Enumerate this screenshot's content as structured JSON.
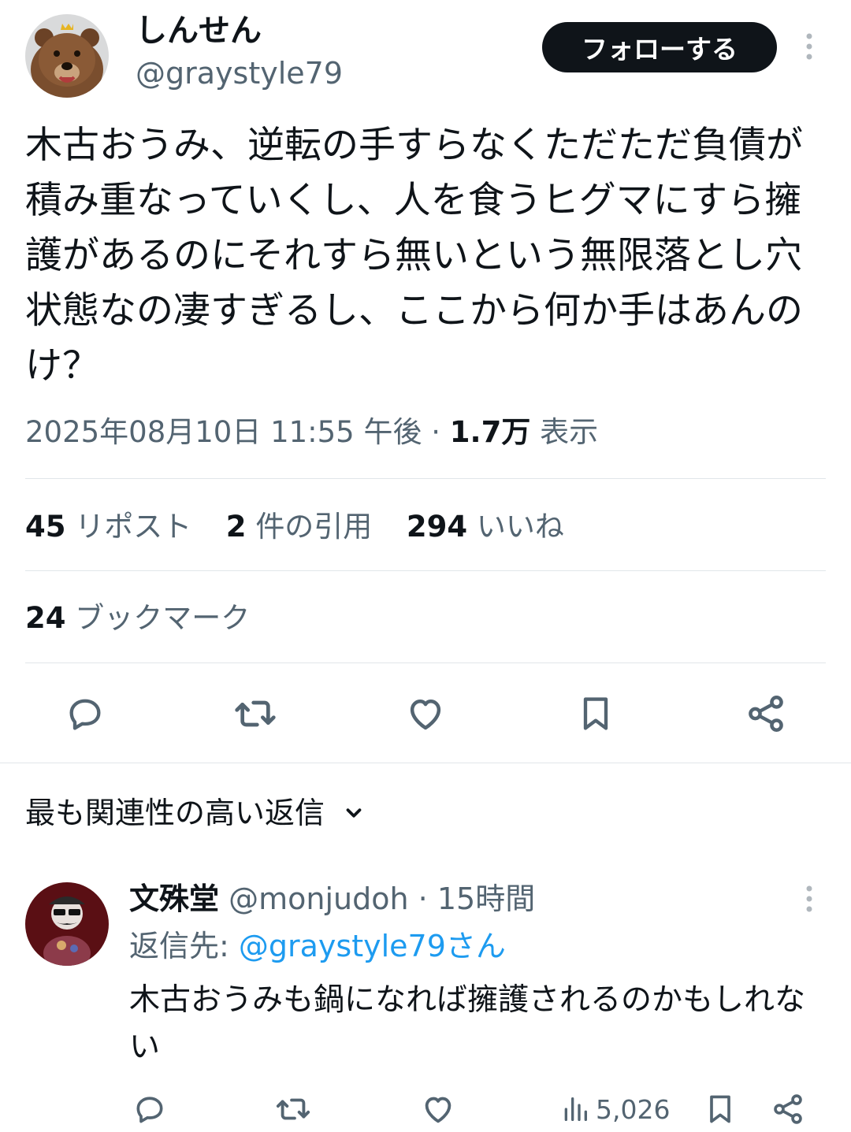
{
  "tweet": {
    "author_name": "しんせん",
    "author_handle": "@graystyle79",
    "follow_label": "フォローする",
    "text": "木古おうみ、逆転の手すらなくただただ負債が積み重なっていくし、人を食うヒグマにすら擁護があるのにそれすら無いという無限落とし穴状態なの凄すぎるし、ここから何か手はあんのけ？",
    "timestamp": "2025年08月10日 11:55 午後",
    "separator": "·",
    "views_count": "1.7万",
    "views_label": "表示",
    "stats": {
      "reposts_count": "45",
      "reposts_label": "リポスト",
      "quotes_count": "2",
      "quotes_label": "件の引用",
      "likes_count": "294",
      "likes_label": "いいね",
      "bookmarks_count": "24",
      "bookmarks_label": "ブックマーク"
    }
  },
  "replies_sort": {
    "label": "最も関連性の高い返信"
  },
  "reply": {
    "author_name": "文殊堂",
    "author_handle": "@monjudoh",
    "separator": "·",
    "time": "15時間",
    "replying_to_label": "返信先:",
    "replying_to_handle": "@graystyle79さん",
    "text": "木古おうみも鍋になれば擁護されるのかもしれない",
    "views": "5,026"
  },
  "colors": {
    "text": "#0f1419",
    "muted": "#536471",
    "link": "#1d9bf0",
    "follow_button_bg": "#0f1419",
    "divider": "#e1e6ea"
  },
  "icons": [
    "bear-avatar",
    "more-icon",
    "reply-icon",
    "retweet-icon",
    "heart-icon",
    "bookmark-icon",
    "share-icon",
    "chevron-down-icon",
    "views-icon"
  ]
}
